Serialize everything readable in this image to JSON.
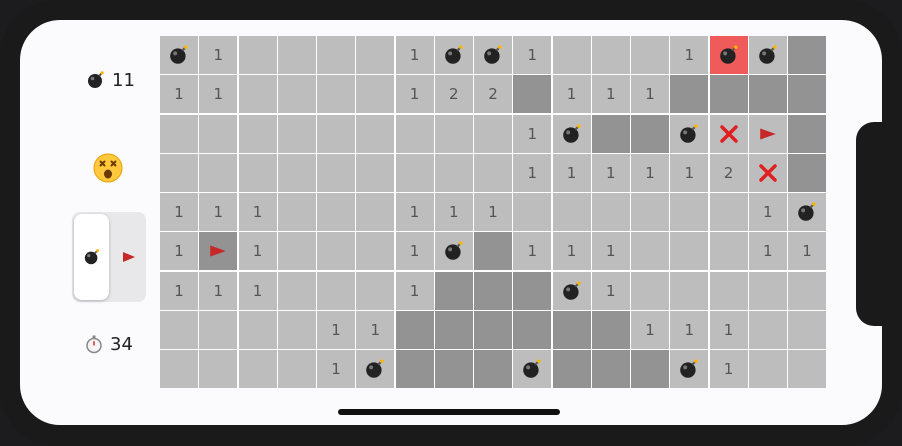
{
  "status": {
    "mines_remaining": "11",
    "timer": "34",
    "face": "dizzy-face",
    "mode_selected": "reveal"
  },
  "icons": {
    "mine": "bomb-icon",
    "flag": "red-flag-icon",
    "wrong": "cross-mark-icon",
    "timer": "stopwatch-icon"
  },
  "colors": {
    "revealed": "#bdbdbd",
    "hidden": "#939393",
    "exploded": "#ef5a5a",
    "flag": "#c62828",
    "cross": "#e02020"
  },
  "board": {
    "rows": 9,
    "cols": 17,
    "grid": [
      [
        "M",
        "1",
        "0",
        "0",
        "0",
        "0",
        "1",
        "M",
        "M",
        "1",
        "0",
        "0",
        "0",
        "1",
        "X",
        "M",
        "H"
      ],
      [
        "1",
        "1",
        "0",
        "0",
        "0",
        "0",
        "1",
        "2",
        "2",
        "H",
        "1",
        "1",
        "1",
        "H",
        "H",
        "H",
        "H"
      ],
      [
        "0",
        "0",
        "0",
        "0",
        "0",
        "0",
        "0",
        "0",
        "0",
        "1",
        "M",
        "H",
        "H",
        "M",
        "W",
        "F",
        "H"
      ],
      [
        "0",
        "0",
        "0",
        "0",
        "0",
        "0",
        "0",
        "0",
        "0",
        "1",
        "1",
        "1",
        "1",
        "1",
        "2",
        "W",
        "H"
      ],
      [
        "1",
        "1",
        "1",
        "0",
        "0",
        "0",
        "1",
        "1",
        "1",
        "0",
        "0",
        "0",
        "0",
        "0",
        "0",
        "1",
        "M"
      ],
      [
        "1",
        "HF",
        "1",
        "0",
        "0",
        "0",
        "1",
        "M",
        "H",
        "1",
        "1",
        "1",
        "0",
        "0",
        "0",
        "1",
        "1"
      ],
      [
        "1",
        "1",
        "1",
        "0",
        "0",
        "0",
        "1",
        "H",
        "H",
        "H",
        "M",
        "1",
        "0",
        "0",
        "0",
        "0",
        "0"
      ],
      [
        "0",
        "0",
        "0",
        "0",
        "1",
        "1",
        "H",
        "H",
        "H",
        "H",
        "H",
        "H",
        "1",
        "1",
        "1",
        "0",
        "0"
      ],
      [
        "0",
        "0",
        "0",
        "0",
        "1",
        "M",
        "H",
        "H",
        "H",
        "M",
        "H",
        "H",
        "H",
        "M",
        "1",
        "0",
        "0"
      ]
    ]
  }
}
